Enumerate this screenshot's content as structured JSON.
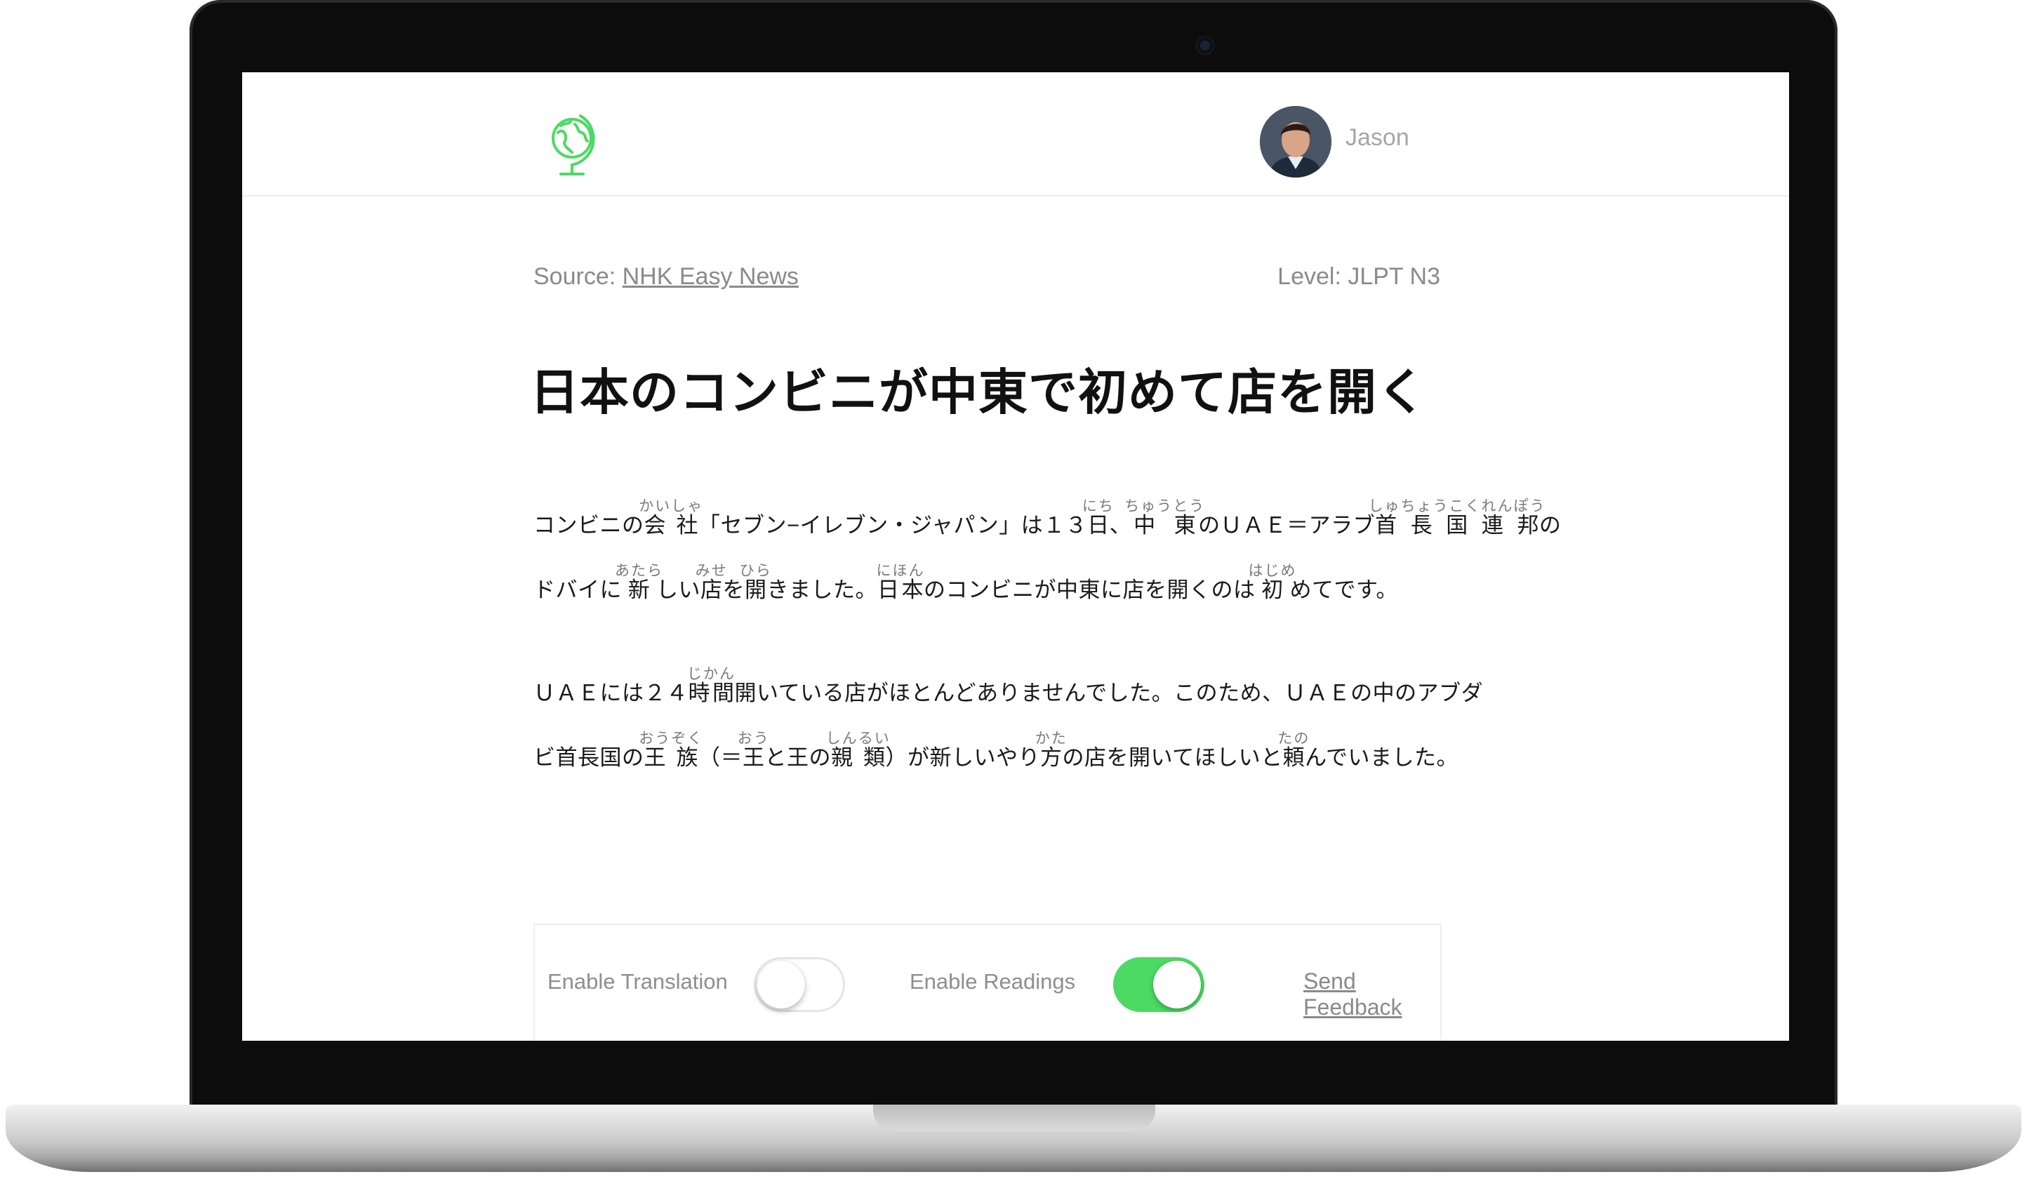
{
  "app": {
    "user_name": "Jason",
    "logo_icon": "globe-icon",
    "accent_color": "#4cd964"
  },
  "meta": {
    "source_prefix": "Source: ",
    "source_link": "NHK Easy News",
    "level": "Level: JLPT N3"
  },
  "article": {
    "title": "日本のコンビニが中東で初めて店を開く",
    "paragraphs": [
      {
        "lines": [
          [
            {
              "t": "コンビニの"
            },
            {
              "t": "会社",
              "r": "かいしゃ"
            },
            {
              "t": "「セブン−イレブン・ジャパン」は１３"
            },
            {
              "t": "日",
              "r": "にち"
            },
            {
              "t": "、"
            },
            {
              "t": "中東",
              "r": "ちゅうとう"
            },
            {
              "t": "のＵＡＥ＝アラブ"
            },
            {
              "t": "首長国連邦",
              "r": "しゅちょうこくれんぽう"
            },
            {
              "t": "の"
            }
          ],
          [
            {
              "t": "ドバイに"
            },
            {
              "t": "新",
              "r": "あたら"
            },
            {
              "t": "しい"
            },
            {
              "t": "店",
              "r": "みせ"
            },
            {
              "t": "を"
            },
            {
              "t": "開",
              "r": "ひら"
            },
            {
              "t": "きました。"
            },
            {
              "t": "日本",
              "r": "にほん"
            },
            {
              "t": "のコンビニが中東に店を開くのは"
            },
            {
              "t": "初",
              "r": "はじめ"
            },
            {
              "t": "めてです。"
            }
          ]
        ]
      },
      {
        "lines": [
          [
            {
              "t": "ＵＡＥには２４"
            },
            {
              "t": "時間",
              "r": "じかん"
            },
            {
              "t": "開いている店がほとんどありませんでした。このため、ＵＡＥの中のアブダ"
            }
          ],
          [
            {
              "t": "ビ首長国の"
            },
            {
              "t": "王族",
              "r": "おうぞく"
            },
            {
              "t": "（＝"
            },
            {
              "t": "王",
              "r": "おう"
            },
            {
              "t": "と王の"
            },
            {
              "t": "親類",
              "r": "しんるい"
            },
            {
              "t": "）が新しいやり"
            },
            {
              "t": "方",
              "r": "かた"
            },
            {
              "t": "の店を開いてほしいと"
            },
            {
              "t": "頼",
              "r": "たの"
            },
            {
              "t": "んでいました。"
            }
          ]
        ]
      }
    ]
  },
  "controls": {
    "translation_label": "Enable Translation",
    "translation_enabled": false,
    "readings_label": "Enable Readings",
    "readings_enabled": true,
    "feedback_label": "Send Feedback"
  }
}
